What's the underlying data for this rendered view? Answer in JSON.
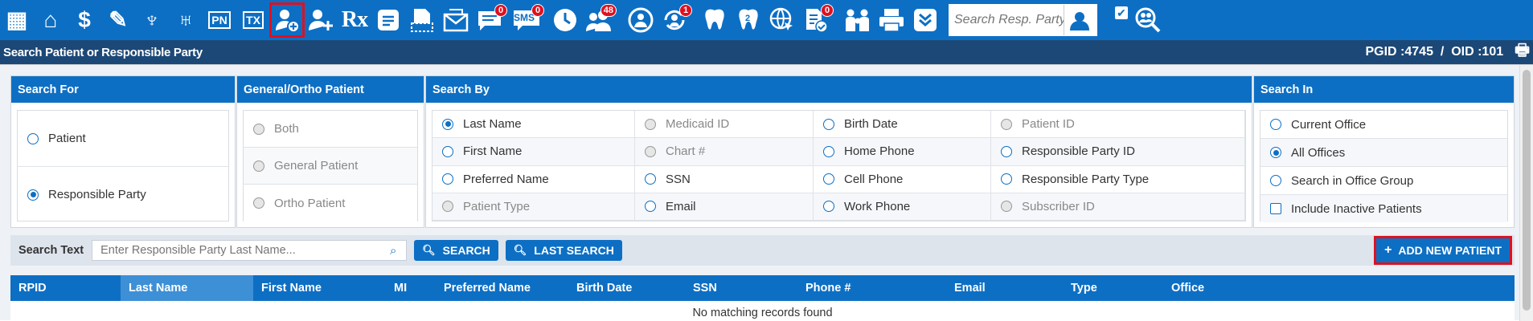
{
  "toolbar": {
    "icons": [
      {
        "name": "calendar-icon",
        "glyph": "▦"
      },
      {
        "name": "home-icon",
        "glyph": "⌂"
      },
      {
        "name": "dollar-icon",
        "glyph": "$"
      },
      {
        "name": "edit-list-icon",
        "glyph": "✎"
      },
      {
        "name": "tooth-icon",
        "glyph": "♆"
      },
      {
        "name": "ortho-tooth-icon",
        "glyph": "♅"
      }
    ],
    "pn_label": "PN",
    "tx_label": "TX",
    "selected_icon": "add-patient-icon",
    "rx_label": "Rx",
    "sms_label": "SMS",
    "badges": {
      "messages": "0",
      "sms": "0",
      "group": "48",
      "alerts": "1",
      "doc_check": "0"
    },
    "search_placeholder": "Search Resp. Party",
    "accent": "#0d6fc4",
    "highlight": "#e0101f"
  },
  "titlebar": {
    "title": "Search Patient or Responsible Party",
    "ids": "PGID :4745  /  OID :101"
  },
  "search_for": {
    "header": "Search For",
    "options": [
      {
        "label": "Patient",
        "selected": false
      },
      {
        "label": "Responsible Party",
        "selected": true
      }
    ]
  },
  "general_ortho": {
    "header": "General/Ortho Patient",
    "options": [
      {
        "label": "Both",
        "disabled": true
      },
      {
        "label": "General Patient",
        "disabled": true
      },
      {
        "label": "Ortho Patient",
        "disabled": true
      }
    ]
  },
  "search_by": {
    "header": "Search By",
    "options": [
      {
        "label": "Last Name",
        "selected": true,
        "disabled": false
      },
      {
        "label": "Medicaid ID",
        "selected": false,
        "disabled": true
      },
      {
        "label": "Birth Date",
        "selected": false,
        "disabled": false
      },
      {
        "label": "Patient ID",
        "selected": false,
        "disabled": true
      },
      {
        "label": "First Name",
        "selected": false,
        "disabled": false
      },
      {
        "label": "Chart #",
        "selected": false,
        "disabled": true
      },
      {
        "label": "Home Phone",
        "selected": false,
        "disabled": false
      },
      {
        "label": "Responsible Party ID",
        "selected": false,
        "disabled": false
      },
      {
        "label": "Preferred Name",
        "selected": false,
        "disabled": false
      },
      {
        "label": "SSN",
        "selected": false,
        "disabled": false
      },
      {
        "label": "Cell Phone",
        "selected": false,
        "disabled": false
      },
      {
        "label": "Responsible Party Type",
        "selected": false,
        "disabled": false
      },
      {
        "label": "Patient Type",
        "selected": false,
        "disabled": true
      },
      {
        "label": "Email",
        "selected": false,
        "disabled": false
      },
      {
        "label": "Work Phone",
        "selected": false,
        "disabled": false
      },
      {
        "label": "Subscriber ID",
        "selected": false,
        "disabled": true
      }
    ]
  },
  "search_in": {
    "header": "Search In",
    "options": [
      {
        "label": "Current Office",
        "selected": false,
        "type": "radio"
      },
      {
        "label": "All Offices",
        "selected": true,
        "type": "radio"
      },
      {
        "label": "Search in Office Group",
        "selected": false,
        "type": "radio"
      },
      {
        "label": "Include Inactive Patients",
        "selected": false,
        "type": "checkbox"
      }
    ]
  },
  "search_row": {
    "label": "Search Text",
    "placeholder": "Enter Responsible Party Last Name...",
    "search_button": "SEARCH",
    "last_search_button": "LAST SEARCH",
    "add_button": "ADD NEW PATIENT"
  },
  "table": {
    "columns": [
      "RPID",
      "Last Name",
      "First Name",
      "MI",
      "Preferred Name",
      "Birth Date",
      "SSN",
      "Phone #",
      "Email",
      "Type",
      "Office"
    ],
    "sorted_column": "Last Name",
    "empty_message": "No matching records found"
  }
}
